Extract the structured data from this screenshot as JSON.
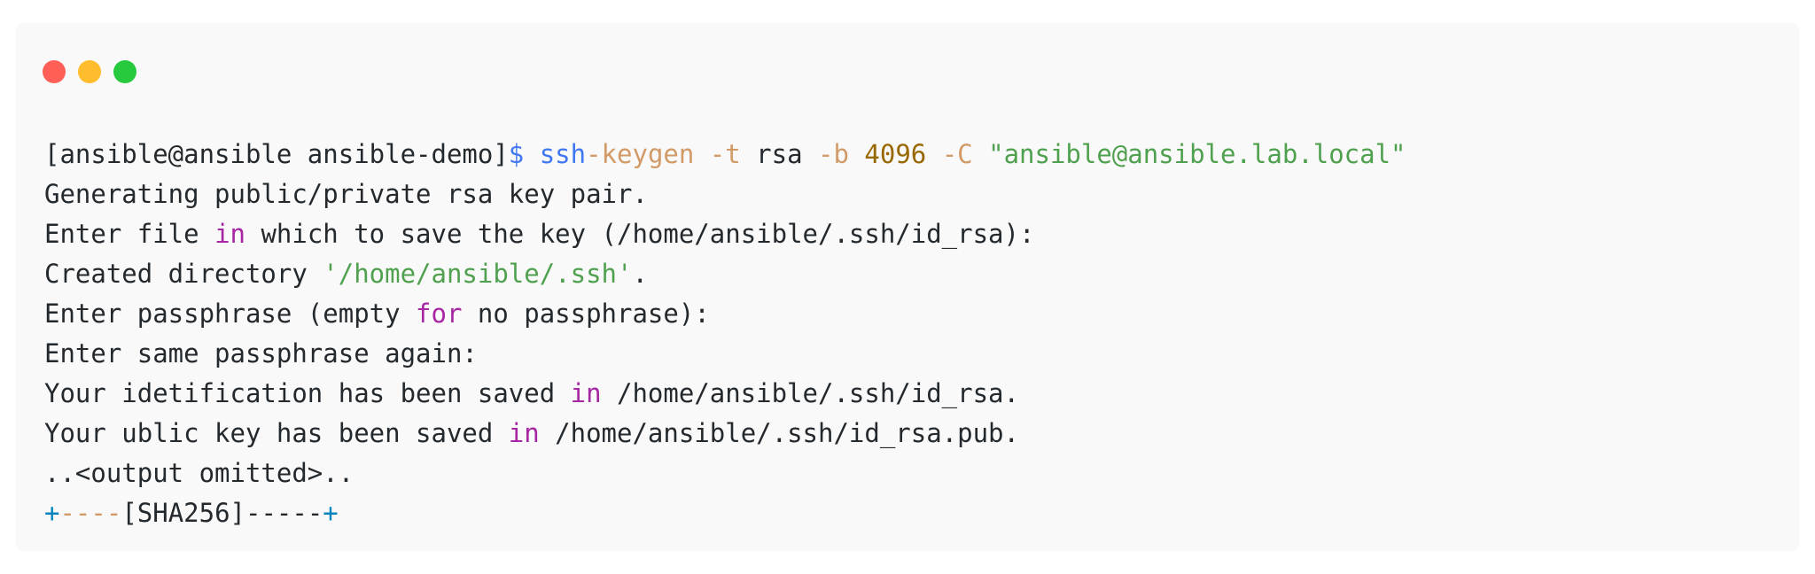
{
  "window": {
    "buttons": [
      "close",
      "minimize",
      "maximize"
    ]
  },
  "colors": {
    "close": "#ff5f56",
    "minimize": "#ffbd2e",
    "maximize": "#27c93f",
    "background": "#f9f9f9"
  },
  "terminal": {
    "line1": {
      "prompt": "[ansible@ansible ansible-demo]",
      "dollar": "$",
      "cmd_a": " ssh",
      "cmd_b": "-keygen",
      "flag_t": " -t",
      "arg_t": " rsa",
      "flag_b": " -b",
      "arg_b": " 4096",
      "flag_c": " -C",
      "arg_c": " \"ansible@ansible.lab.local\""
    },
    "line2": {
      "text": "Generating public/private rsa key pair."
    },
    "line3": {
      "pre": "Enter file ",
      "kw": "in",
      "post": " which to save the key (/home/ansible/.ssh/id_rsa):"
    },
    "line4": {
      "pre": "Created directory ",
      "str": "'/home/ansible/.ssh'",
      "post": "."
    },
    "line5": {
      "pre": "Enter passphrase (empty ",
      "kw": "for",
      "post": " no passphrase):"
    },
    "line6": {
      "text": "Enter same passphrase again:"
    },
    "line7": {
      "pre": "Your idetification has been saved ",
      "kw": "in",
      "post": " /home/ansible/.ssh/id_rsa."
    },
    "line8": {
      "pre": "Your ublic key has been saved ",
      "kw": "in",
      "post": " /home/ansible/.ssh/id_rsa.pub."
    },
    "line9": {
      "text": "..<output omitted>.."
    },
    "line10": {
      "plus_a": "+",
      "dash_a": "----",
      "mid": "[SHA256]-----",
      "plus_b": "+"
    }
  }
}
